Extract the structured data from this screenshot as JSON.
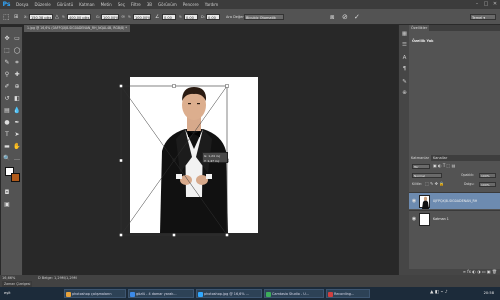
{
  "app": {
    "logo": "Ps",
    "accent": "#31a8ff"
  },
  "menu": {
    "items": [
      "Dosya",
      "Düzenle",
      "Görüntü",
      "Katman",
      "Metin",
      "Seç",
      "Filtre",
      "3B",
      "Görünüm",
      "Pencere",
      "Yardım"
    ],
    "window_controls": [
      "–",
      "□",
      "✕"
    ]
  },
  "options_bar": {
    "x_value": "150,38 piks",
    "y_value": "400,00 piks",
    "w_value": "100,00%",
    "h_value": "100,00%",
    "angle_value": "0,00",
    "h_skew_value": "0,00",
    "v_skew_value": "0,00",
    "interpolation": "Bicubic Otomatik",
    "commit_icon": "check-icon",
    "cancel_icon": "cancel-icon"
  },
  "document_tab": {
    "title": "1.jpg @ 16,6% (0AFFQXJ8-SIG0ADENAN_RH_NQAL4B, RGB/8) *",
    "close": "×"
  },
  "canvas": {
    "transform_readout": "G: 1,24 inç\nY: 1,47 inç"
  },
  "history_panel": {
    "tab_label": "Özellikler",
    "content": "Özellik Yok"
  },
  "layers_panel": {
    "tabs": [
      "Katmanlar",
      "Kanallar"
    ],
    "filter": "Tür",
    "blend_mode": "Normal",
    "opacity_label": "Opaklık:",
    "opacity_value": "100%",
    "lock_label": "Kilitle:",
    "fill_label": "Dolgu:",
    "fill_value": "100%",
    "layers": [
      {
        "name": "0JFPQXJ8-SIG0ADENAN_RH",
        "visible": true,
        "selected": true
      },
      {
        "name": "Katman 1",
        "visible": true,
        "selected": false
      }
    ]
  },
  "status_bar": {
    "zoom": "16,66%",
    "doc_size": "D Belge: 1,29M/1,29M",
    "mini_tab": "Zaman Çizelgesi"
  },
  "taskbar": {
    "start": "eşit",
    "items": [
      {
        "label": "photoshop çalışmaların",
        "color": "#e8a33c"
      },
      {
        "label": "gözlü - 4 damar yarak...",
        "color": "#3c8ae8"
      },
      {
        "label": "photoshop.jpg @ 16,6% ...",
        "color": "#31a8ff"
      },
      {
        "label": "Camtasia Studio - U...",
        "color": "#3cae5a"
      },
      {
        "label": "Recording...",
        "color": "#d04040"
      }
    ],
    "clock": "20:58"
  }
}
